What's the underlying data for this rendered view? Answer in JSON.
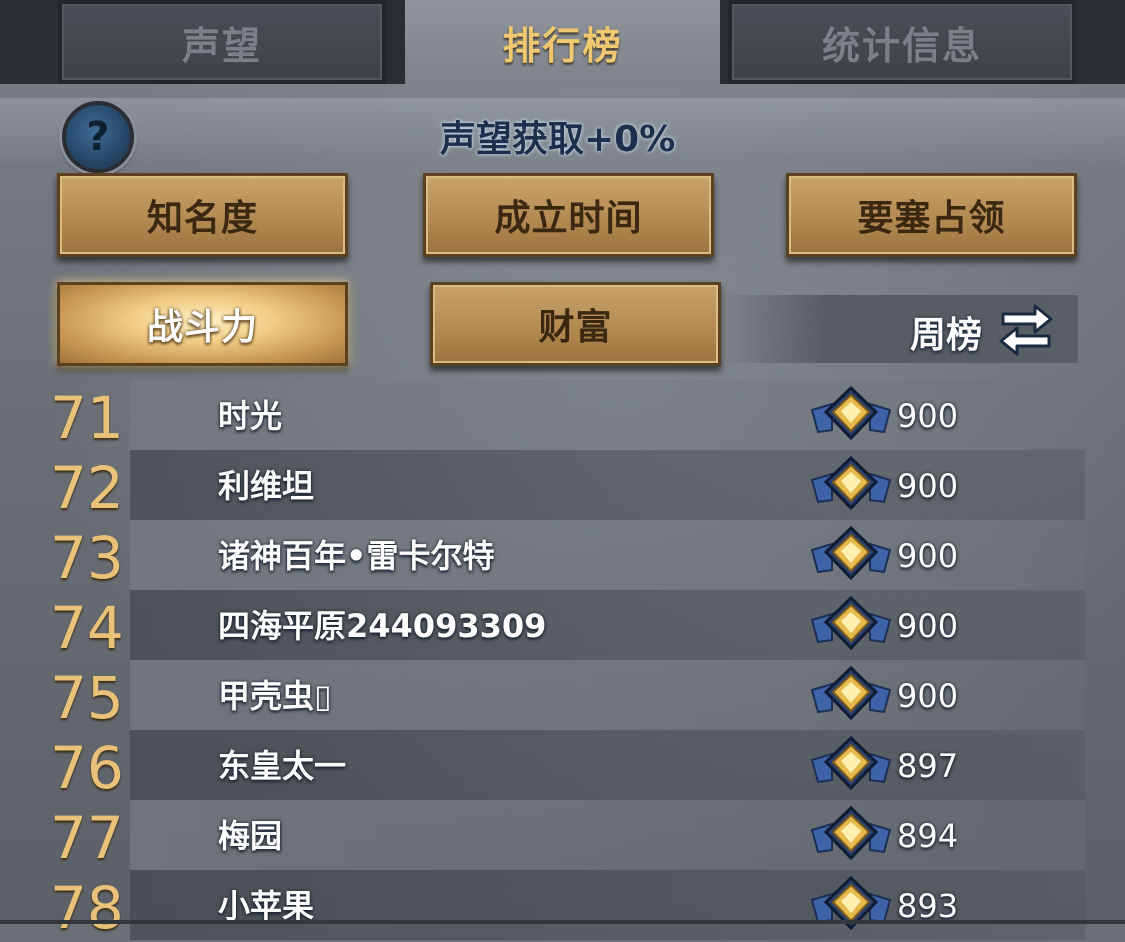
{
  "tabs": [
    {
      "label": "声望",
      "active": false
    },
    {
      "label": "排行榜",
      "active": true
    },
    {
      "label": "统计信息",
      "active": false
    }
  ],
  "header": {
    "help_icon": "help-question-icon",
    "gain_text": "声望获取+0%"
  },
  "categories": [
    {
      "label": "知名度",
      "selected": false
    },
    {
      "label": "成立时间",
      "selected": false
    },
    {
      "label": "要塞占领",
      "selected": false
    },
    {
      "label": "战斗力",
      "selected": true
    },
    {
      "label": "财富",
      "selected": false
    }
  ],
  "weekly": {
    "label": "周榜",
    "icon": "swap-arrows-icon"
  },
  "rankings": [
    {
      "rank": "71",
      "name": "时光",
      "score": "900"
    },
    {
      "rank": "72",
      "name": "利维坦",
      "score": "900"
    },
    {
      "rank": "73",
      "name": "诸神百年•雷卡尔特",
      "score": "900"
    },
    {
      "rank": "74",
      "name": "四海平原244093309",
      "score": "900"
    },
    {
      "rank": "75",
      "name": "甲壳虫▯",
      "score": "900"
    },
    {
      "rank": "76",
      "name": "东皇太一",
      "score": "897"
    },
    {
      "rank": "77",
      "name": "梅园",
      "score": "894"
    },
    {
      "rank": "78",
      "name": "小苹果",
      "score": "893"
    }
  ],
  "colors": {
    "gold_text": "#e9c27a",
    "tab_active_text": "#f0c870",
    "button_face": "#b48a52"
  }
}
